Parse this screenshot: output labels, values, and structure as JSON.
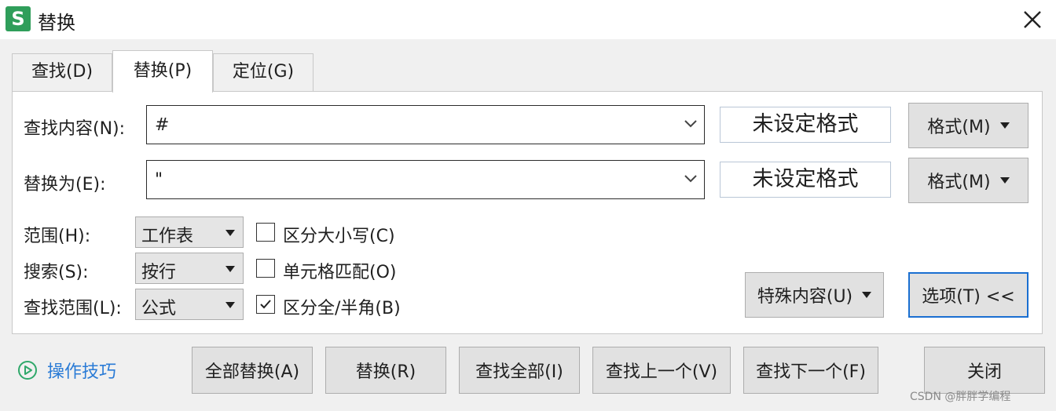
{
  "window": {
    "title": "替换",
    "app_icon_letter": "S",
    "accent_color": "#2f9e5a",
    "close_icon": "close-icon"
  },
  "tabs": [
    {
      "label": "查找(D)",
      "active": false
    },
    {
      "label": "替换(P)",
      "active": true
    },
    {
      "label": "定位(G)",
      "active": false
    }
  ],
  "find": {
    "label": "查找内容(N):",
    "value": "#",
    "format_status": "未设定格式",
    "format_button": "格式(M)"
  },
  "replace": {
    "label": "替换为(E):",
    "value": "\"",
    "format_status": "未设定格式",
    "format_button": "格式(M)"
  },
  "options": {
    "scope": {
      "label": "范围(H):",
      "value": "工作表"
    },
    "search": {
      "label": "搜索(S):",
      "value": "按行"
    },
    "lookin": {
      "label": "查找范围(L):",
      "value": "公式"
    },
    "match_case": {
      "label": "区分大小写(C)",
      "checked": false
    },
    "match_cell": {
      "label": "单元格匹配(O)",
      "checked": false
    },
    "match_width": {
      "label": "区分全/半角(B)",
      "checked": true
    }
  },
  "special_button": "特殊内容(U)",
  "options_button": "选项(T) <<",
  "tips_link": "操作技巧",
  "actions": {
    "replace_all": "全部替换(A)",
    "replace": "替换(R)",
    "find_all": "查找全部(I)",
    "find_prev": "查找上一个(V)",
    "find_next": "查找下一个(F)",
    "close": "关闭"
  },
  "watermark": "CSDN @胖胖学编程"
}
